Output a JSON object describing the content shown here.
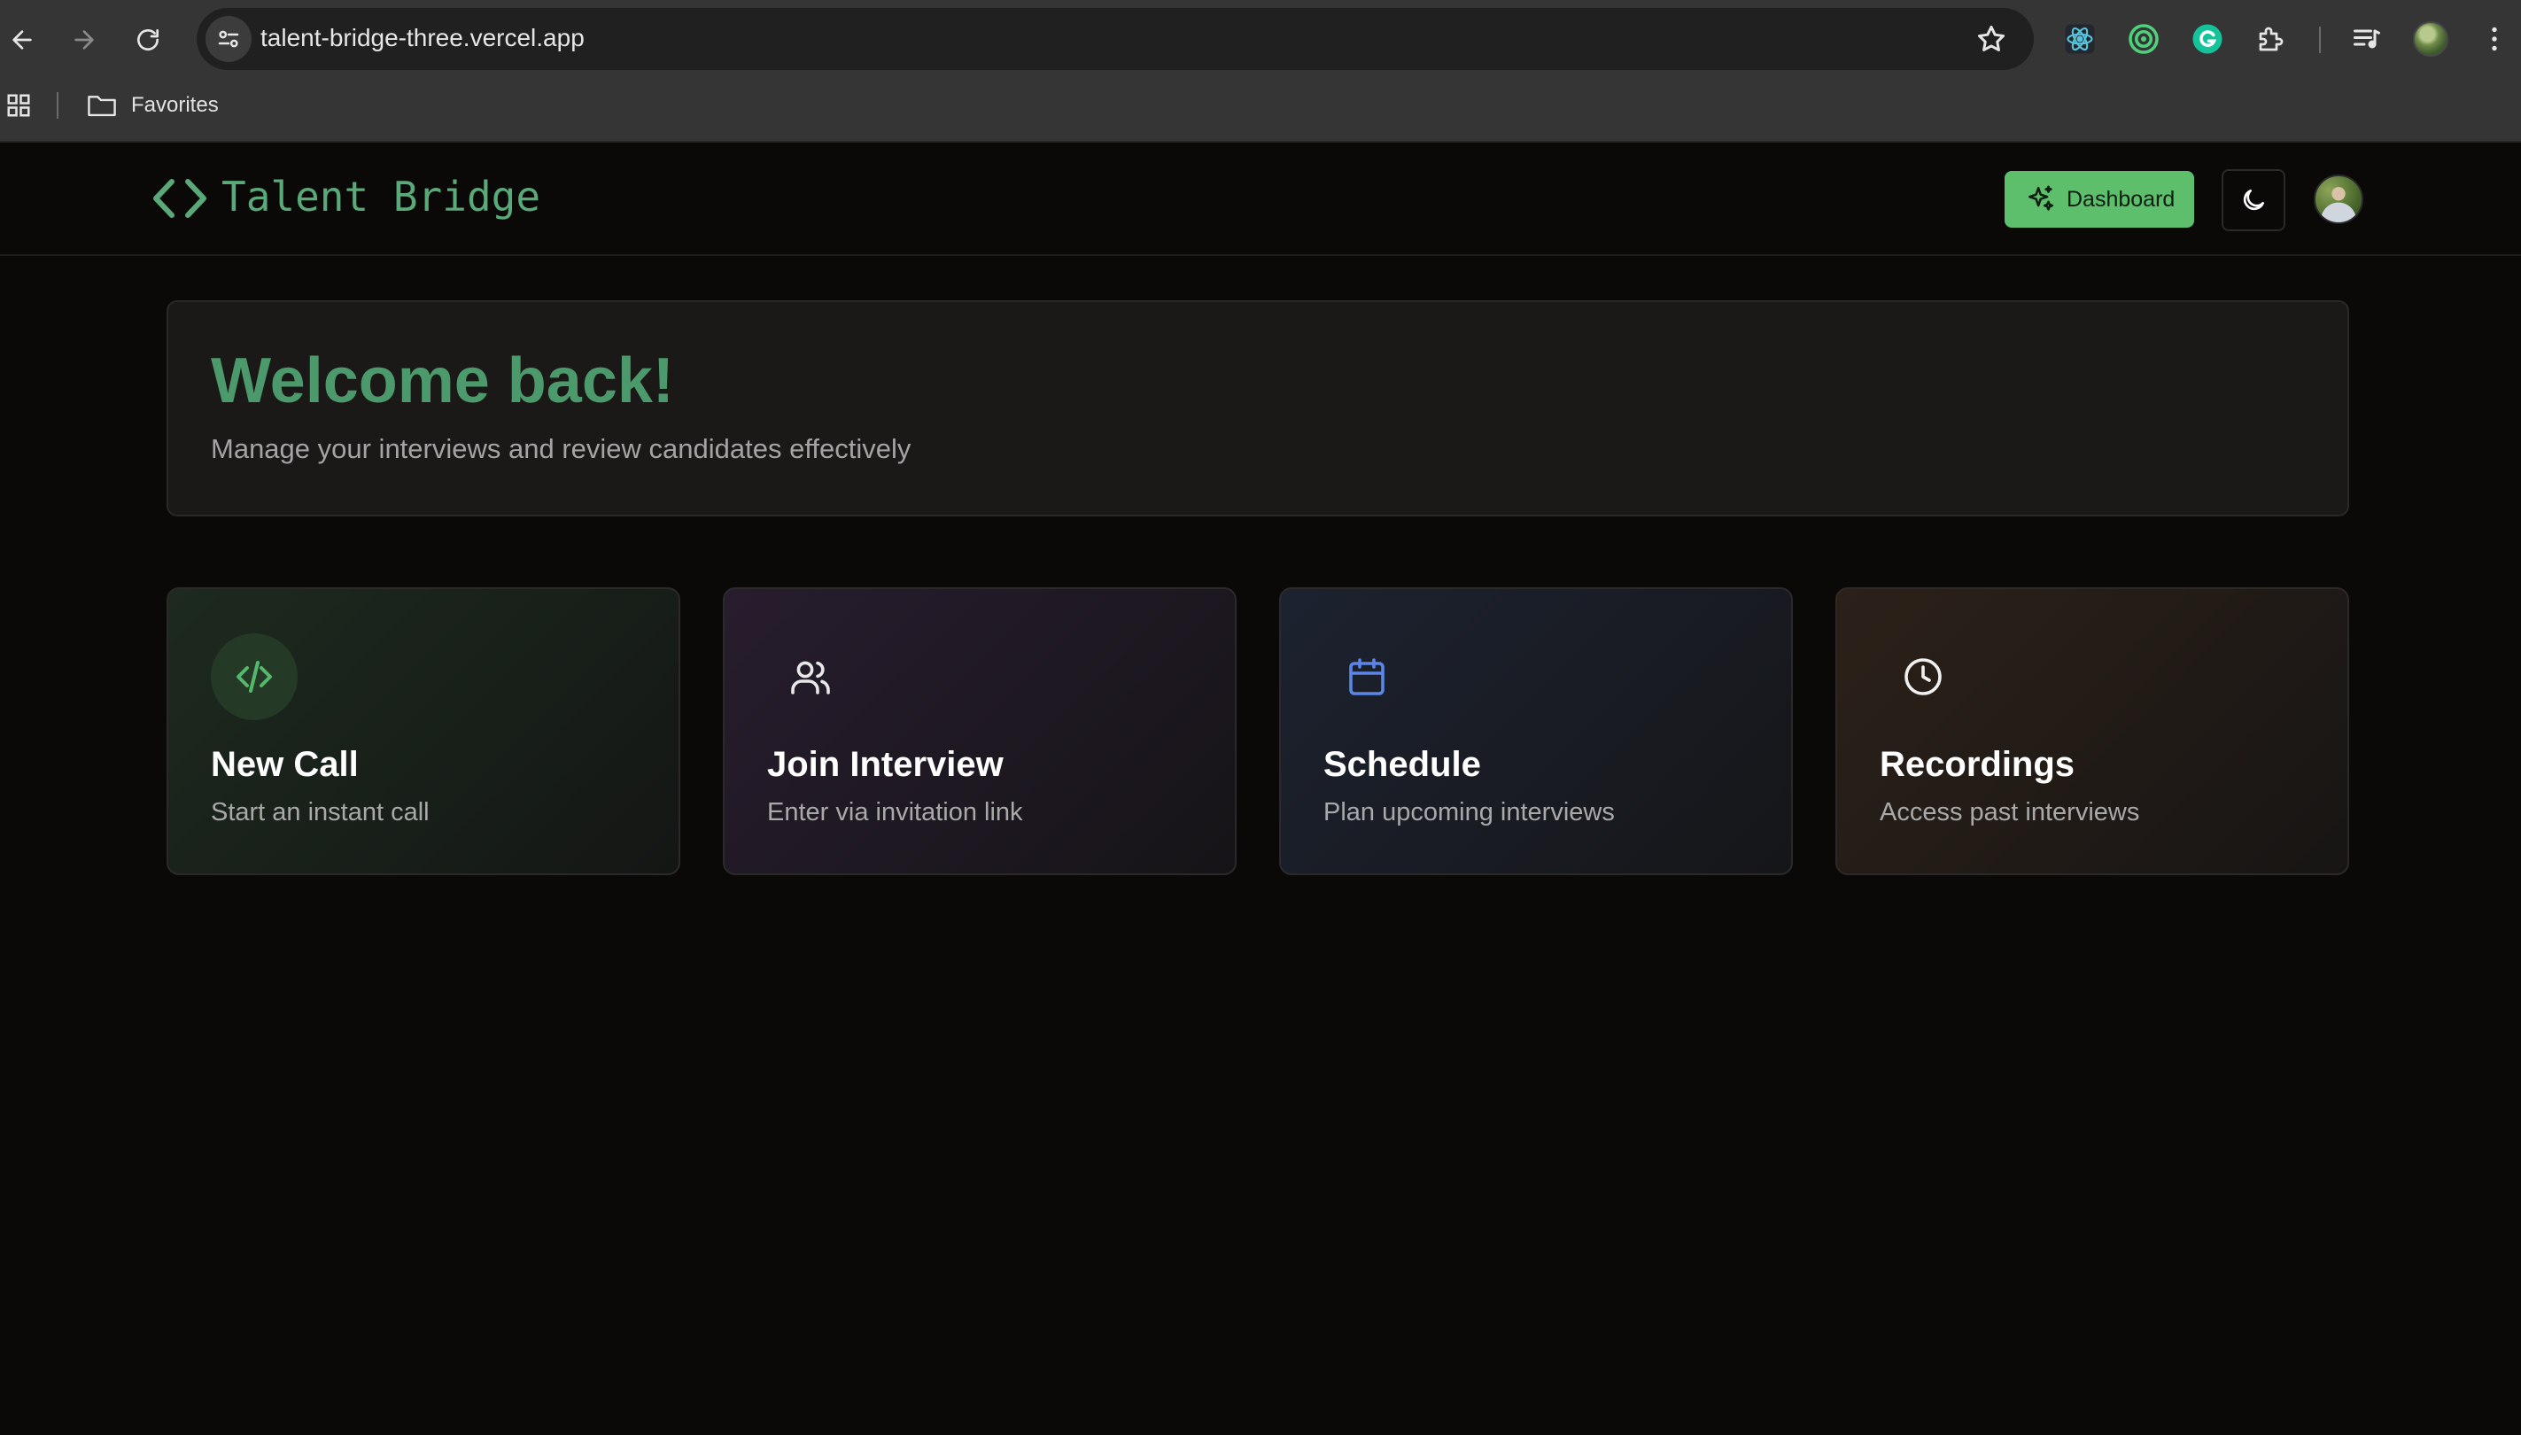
{
  "browser": {
    "url": "talent-bridge-three.vercel.app",
    "bookmarks": [
      {
        "label": "Favorites"
      }
    ],
    "icons": [
      "back-arrow-icon",
      "forward-arrow-icon",
      "reload-icon",
      "site-settings-icon",
      "bookmark-star-icon",
      "react-devtools-icon",
      "extension-target-icon",
      "grammarly-icon",
      "extensions-puzzle-icon",
      "media-controls-icon",
      "chrome-menu-icon"
    ]
  },
  "header": {
    "brand": "Talent Bridge",
    "dashboard_label": "Dashboard",
    "brand_color": "#5aa978",
    "accent_color": "#5dbf6c"
  },
  "welcome": {
    "title": "Welcome back!",
    "subtitle": "Manage your interviews and review candidates effectively"
  },
  "actions": [
    {
      "title": "New Call",
      "description": "Start an instant call",
      "icon": "code-icon",
      "color": "#55b86a"
    },
    {
      "title": "Join Interview",
      "description": "Enter via invitation link",
      "icon": "users-icon",
      "color": "#e8e8e8"
    },
    {
      "title": "Schedule",
      "description": "Plan upcoming interviews",
      "icon": "calendar-icon",
      "color": "#5b86e6"
    },
    {
      "title": "Recordings",
      "description": "Access past interviews",
      "icon": "clock-icon",
      "color": "#f0f0f0"
    }
  ]
}
